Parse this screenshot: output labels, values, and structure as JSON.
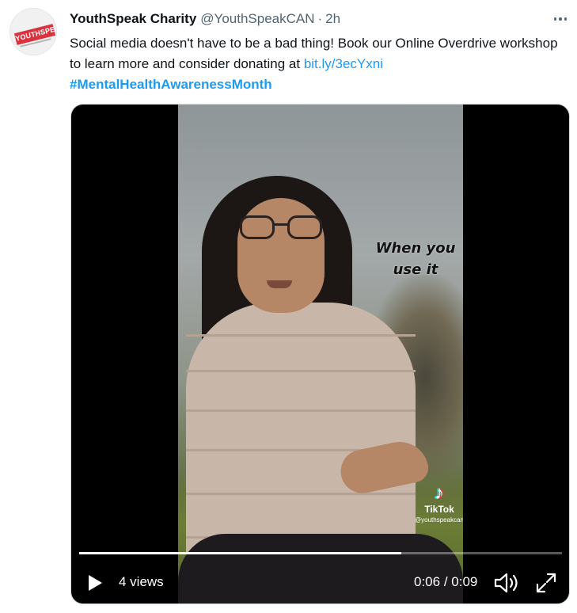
{
  "tweet": {
    "author": {
      "name": "YouthSpeak Charity",
      "handle": "@YouthSpeakCAN",
      "separator": "·",
      "time": "2h",
      "avatar_logo_text": "YOUTHSPEAK"
    },
    "text_before_link": "Social media doesn't have to be a bad thing! Book our Online Overdrive workshop to learn more and consider donating at ",
    "link": "bit.ly/3ecYxni",
    "hashtag": "#MentalHealthAwarenessMonth"
  },
  "video": {
    "overlay_caption_line1": "When you",
    "overlay_caption_line2": "use it",
    "watermark_label": "TikTok",
    "watermark_user": "@youthspeakcan",
    "views": "4 views",
    "current_time": "0:06",
    "time_separator": " / ",
    "duration": "0:09",
    "progress_fraction": 0.667
  },
  "icons": [
    "more-icon",
    "play-icon",
    "volume-icon",
    "fullscreen-icon",
    "tiktok-logo-icon"
  ],
  "colors": {
    "link": "#1d9bf0",
    "text": "#0f1419",
    "secondary": "#536471",
    "logo_red": "#d9333f"
  }
}
